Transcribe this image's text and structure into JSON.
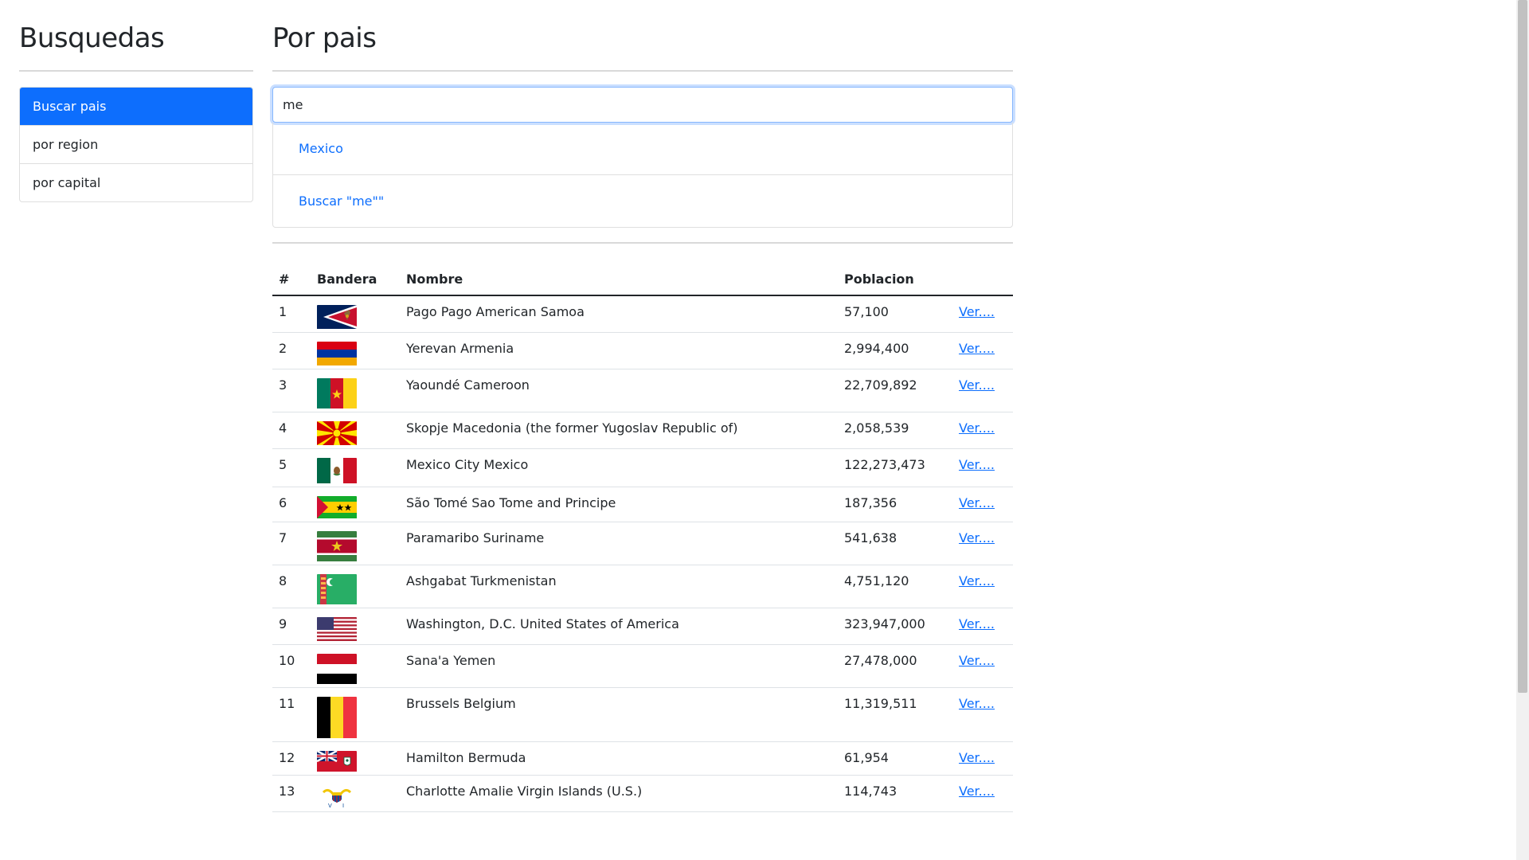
{
  "sidebar": {
    "title": "Busquedas",
    "items": [
      {
        "label": "Buscar pais",
        "active": true
      },
      {
        "label": "por region",
        "active": false
      },
      {
        "label": "por capital",
        "active": false
      }
    ]
  },
  "main": {
    "title": "Por pais",
    "search": {
      "value": "me"
    },
    "suggestions": [
      "Mexico",
      "Buscar \"me\"\""
    ],
    "table": {
      "headers": [
        "#",
        "Bandera",
        "Nombre",
        "Poblacion",
        ""
      ],
      "link_label": "Ver....",
      "rows": [
        {
          "n": "1",
          "flag": "american-samoa",
          "name": "Pago Pago American Samoa",
          "population": "57,100"
        },
        {
          "n": "2",
          "flag": "armenia",
          "name": "Yerevan Armenia",
          "population": "2,994,400"
        },
        {
          "n": "3",
          "flag": "cameroon",
          "name": "Yaoundé Cameroon",
          "population": "22,709,892"
        },
        {
          "n": "4",
          "flag": "macedonia",
          "name": "Skopje Macedonia (the former Yugoslav Republic of)",
          "population": "2,058,539"
        },
        {
          "n": "5",
          "flag": "mexico",
          "name": "Mexico City Mexico",
          "population": "122,273,473"
        },
        {
          "n": "6",
          "flag": "sao-tome",
          "name": "São Tomé Sao Tome and Principe",
          "population": "187,356"
        },
        {
          "n": "7",
          "flag": "suriname",
          "name": "Paramaribo Suriname",
          "population": "541,638"
        },
        {
          "n": "8",
          "flag": "turkmenistan",
          "name": "Ashgabat Turkmenistan",
          "population": "4,751,120"
        },
        {
          "n": "9",
          "flag": "usa",
          "name": "Washington, D.C. United States of America",
          "population": "323,947,000"
        },
        {
          "n": "10",
          "flag": "yemen",
          "name": "Sana'a Yemen",
          "population": "27,478,000"
        },
        {
          "n": "11",
          "flag": "belgium",
          "name": "Brussels Belgium",
          "population": "11,319,511"
        },
        {
          "n": "12",
          "flag": "bermuda",
          "name": "Hamilton Bermuda",
          "population": "61,954"
        },
        {
          "n": "13",
          "flag": "virgin-islands-us",
          "name": "Charlotte Amalie Virgin Islands (U.S.)",
          "population": "114,743"
        }
      ]
    }
  },
  "colors": {
    "primary": "#0d6efd",
    "text": "#212529"
  }
}
